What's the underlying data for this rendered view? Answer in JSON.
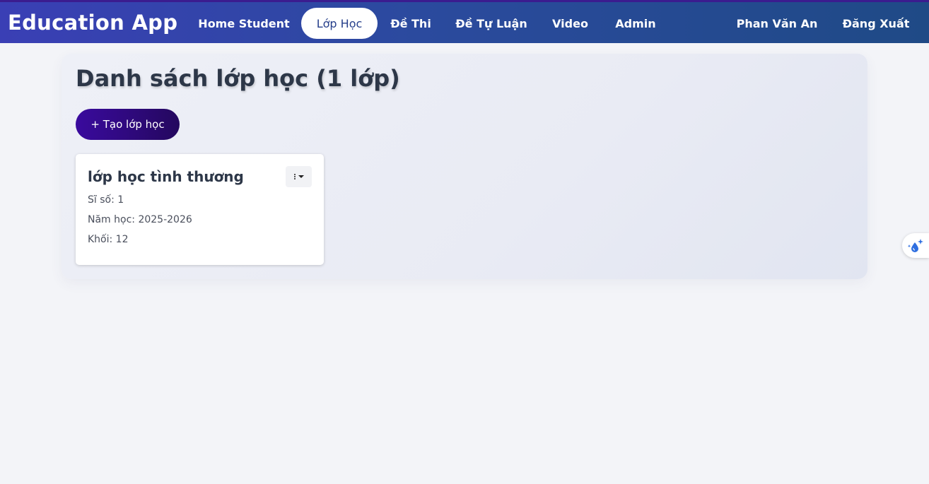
{
  "navbar": {
    "brand": "Education App",
    "items": [
      {
        "label": "Home Student"
      },
      {
        "label": "Lớp Học"
      },
      {
        "label": "Đề Thi"
      },
      {
        "label": "Đề Tự Luận"
      },
      {
        "label": "Video"
      },
      {
        "label": "Admin"
      }
    ],
    "user_name": "Phan Văn An",
    "logout_label": "Đăng Xuất",
    "active_item": "Lớp Học"
  },
  "main": {
    "title": "Danh sách lớp học (1 lớp)",
    "create_button_label": "+ Tạo lớp học",
    "classes": [
      {
        "name": "lớp học tình thương",
        "size_text": "Sĩ số: 1",
        "year_text": "Năm học: 2025-2026",
        "grade_text": "Khối: 12"
      }
    ]
  },
  "icons": {
    "card_menu": "kebab-menu-icon",
    "floating": "sparkle-drop-icon"
  },
  "colors": {
    "navbar_start": "#3a3fb5",
    "navbar_end": "#1f4a86",
    "button_start": "#3a0a9e",
    "button_end": "#24085e",
    "title_text": "#2d3748"
  }
}
